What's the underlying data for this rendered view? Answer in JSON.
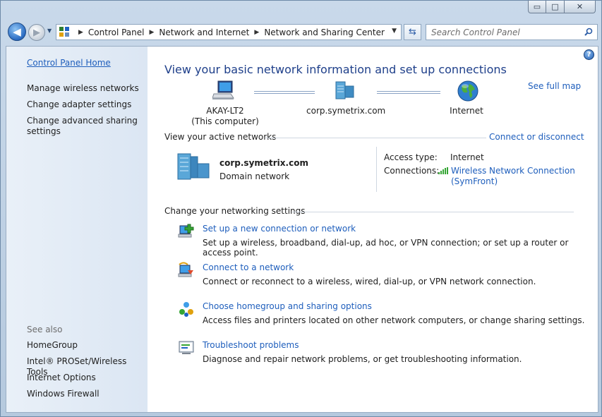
{
  "window": {
    "caption_buttons": {
      "minimize": "▭",
      "maximize": "□",
      "close": "✕"
    }
  },
  "nav": {
    "back_glyph": "◀",
    "forward_glyph": "▶",
    "history_glyph": "▼",
    "breadcrumbs": [
      "Control Panel",
      "Network and Internet",
      "Network and Sharing Center"
    ],
    "crumb_separator": "▶",
    "address_dropdown": "▼",
    "refresh_glyph": "⇆",
    "search_placeholder": "Search Control Panel"
  },
  "sidebar": {
    "home": "Control Panel Home",
    "tasks": [
      "Manage wireless networks",
      "Change adapter settings",
      "Change advanced sharing",
      "settings"
    ],
    "see_also_label": "See also",
    "see_also": [
      "HomeGroup",
      "Intel® PROSet/Wireless Tools",
      "Internet Options",
      "Windows Firewall"
    ]
  },
  "help_glyph": "?",
  "main": {
    "title": "View your basic network information and set up connections",
    "see_full_map": "See full map",
    "map": {
      "computer_name": "AKAY-LT2",
      "computer_sub": "(This computer)",
      "domain": "corp.symetrix.com",
      "internet": "Internet"
    },
    "active_networks": {
      "heading": "View your active networks",
      "connect_link": "Connect or disconnect",
      "network_name": "corp.symetrix.com",
      "network_type": "Domain network",
      "access_type_label": "Access type:",
      "access_type_value": "Internet",
      "connections_label": "Connections:",
      "connection_name": "Wireless Network Connection",
      "connection_ssid": "(SymFront)"
    },
    "settings": {
      "heading": "Change your networking settings",
      "tasks": [
        {
          "title": "Set up a new connection or network",
          "desc": "Set up a wireless, broadband, dial-up, ad hoc, or VPN connection; or set up a router or access point."
        },
        {
          "title": "Connect to a network",
          "desc": "Connect or reconnect to a wireless, wired, dial-up, or VPN network connection."
        },
        {
          "title": "Choose homegroup and sharing options",
          "desc": "Access files and printers located on other network computers, or change sharing settings."
        },
        {
          "title": "Troubleshoot problems",
          "desc": "Diagnose and repair network problems, or get troubleshooting information."
        }
      ]
    }
  },
  "colors": {
    "link": "#1e5ebc",
    "title": "#1e3f8a",
    "sidebar": "#e3ecf6"
  }
}
